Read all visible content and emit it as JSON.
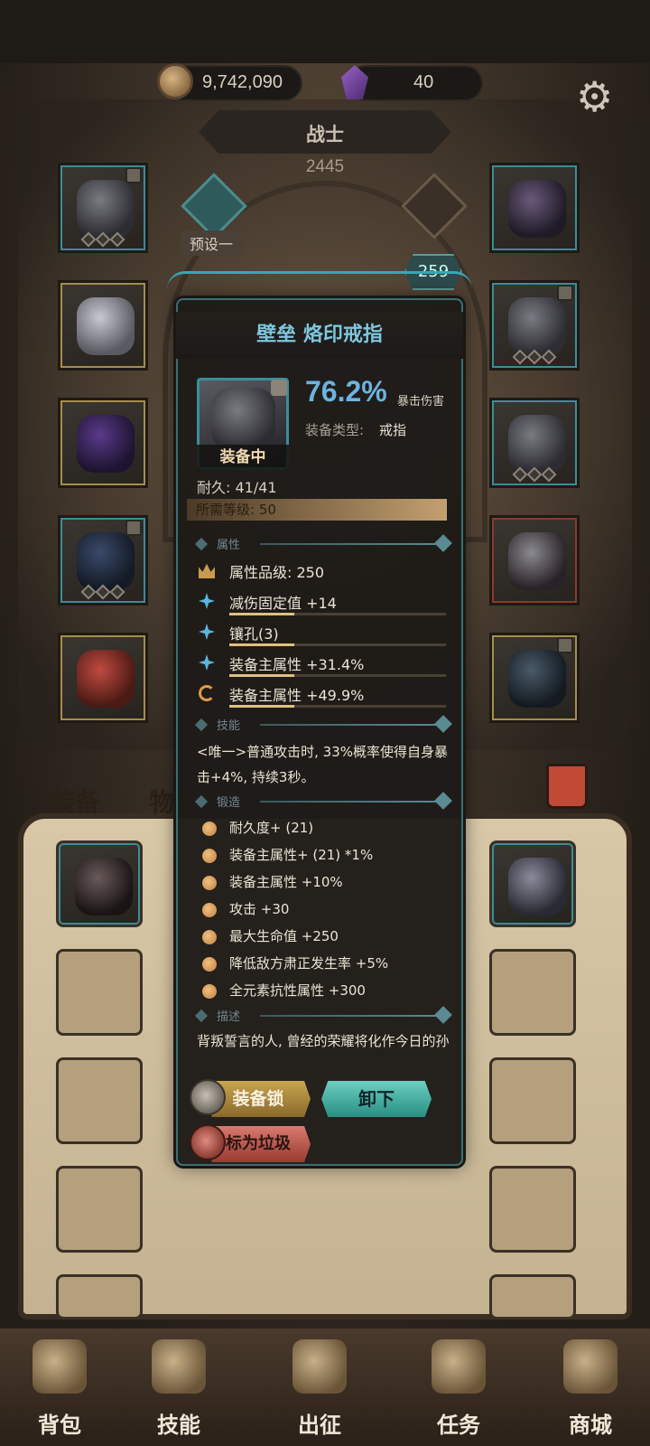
{
  "currency": {
    "gold": "9,742,090",
    "gems": "40"
  },
  "character": {
    "class_name": "战士",
    "power": "2445",
    "preset_label": "预设一",
    "level": "259"
  },
  "bag": {
    "tab_equipment": "装备",
    "tab_items": "物品"
  },
  "nav": {
    "backpack": "背包",
    "skills": "技能",
    "expedition": "出征",
    "quests": "任务",
    "shop": "商城"
  },
  "popup": {
    "title": "壁垒 烙印戒指",
    "equipped_label": "装备中",
    "stat_value": "76.2%",
    "stat_name": "暴击伤害",
    "equip_type_label": "装备类型:",
    "equip_type_value": "戒指",
    "durability": "耐久: 41/41",
    "required_level": "所需等级: 50",
    "sections": {
      "attributes": "属性",
      "skill": "技能",
      "forge": "锻造",
      "description": "描述"
    },
    "attributes": [
      {
        "text": "属性品级: 250",
        "icon": "crown-icon",
        "has_bar": false
      },
      {
        "text": "减伤固定值 +14",
        "icon": "star-icon",
        "has_bar": true
      },
      {
        "text": "镶孔(3)",
        "icon": "star-icon",
        "has_bar": true
      },
      {
        "text": "装备主属性 +31.4%",
        "icon": "star-icon",
        "has_bar": true
      },
      {
        "text": "装备主属性 +49.9%",
        "icon": "cycle-icon",
        "has_bar": true
      }
    ],
    "skill_text": "<唯一>普通攻击时, 33%概率使得自身暴击+4%, 持续3秒。",
    "forge": [
      "耐久度+ (21)",
      "装备主属性+ (21) *1%",
      "装备主属性 +10%",
      "攻击 +30",
      "最大生命值 +250",
      "降低敌方肃正发生率 +5%",
      "全元素抗性属性 +300"
    ],
    "description": "背叛誓言的人, 曾经的荣耀将化作今日的孙下枷锁",
    "buttons": {
      "lock": "装备锁",
      "unequip": "卸下",
      "mark_trash": "标为垃圾"
    }
  },
  "colors": {
    "accent_teal": "#3aa6b4",
    "title_blue": "#7ec6de",
    "stat_blue": "#6ab4e0",
    "gold": "#c8a450"
  }
}
